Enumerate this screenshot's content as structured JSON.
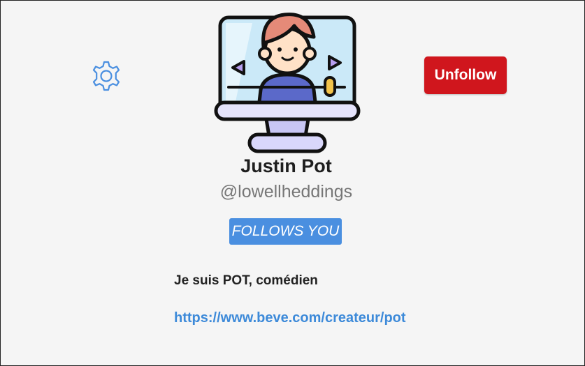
{
  "profile": {
    "name": "Justin Pot",
    "handle": "@lowellheddings",
    "follows_badge": "FOLLOWS YOU",
    "bio": "Je suis POT, comédien",
    "website": "https://www.beve.com/createur/pot"
  },
  "actions": {
    "unfollow_label": "Unfollow"
  },
  "icons": {
    "settings": "gear-icon",
    "avatar": "streamer-monitor-avatar"
  },
  "colors": {
    "unfollow": "#d0161d",
    "badge": "#4a8fe0",
    "link": "#3d8ad9",
    "gear": "#4a8fe0"
  }
}
